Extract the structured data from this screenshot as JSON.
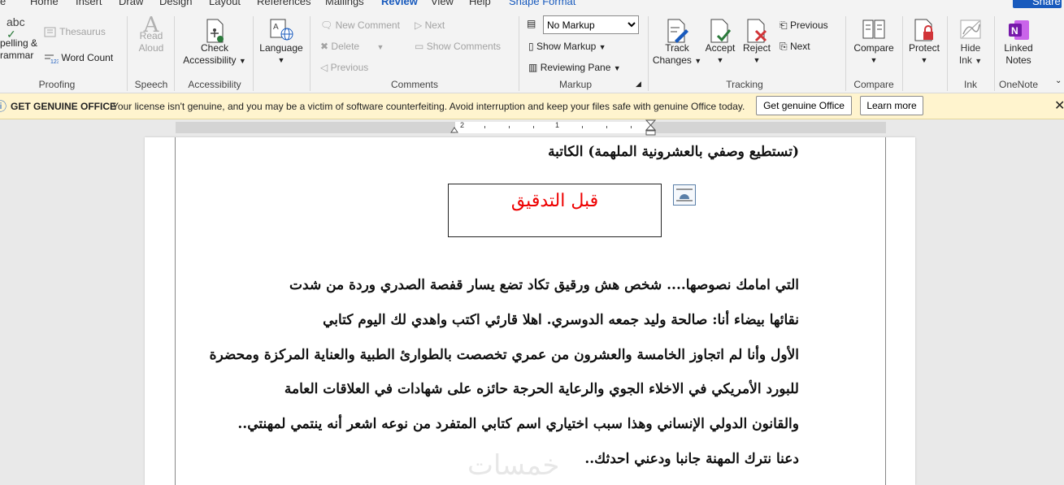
{
  "tabs": [
    "e",
    "Home",
    "Insert",
    "Draw",
    "Design",
    "Layout",
    "References",
    "Mailings",
    "Review",
    "View",
    "Help",
    "Shape Format"
  ],
  "share_label": "Share",
  "ribbon": {
    "proofing": {
      "spelling": "pelling &",
      "grammar": "rammar",
      "thesaurus": "Thesaurus",
      "word_count": "Word Count",
      "label": "Proofing"
    },
    "speech": {
      "read": "Read",
      "aloud": "Aloud",
      "label": "Speech"
    },
    "accessibility": {
      "check": "Check",
      "access": "Accessibility",
      "label": "Accessibility"
    },
    "language": {
      "btn": "Language",
      "label": ""
    },
    "comments": {
      "new": "New Comment",
      "delete": "Delete",
      "previous": "Previous",
      "next": "Next",
      "show": "Show Comments",
      "label": "Comments"
    },
    "markup": {
      "select": "No Markup",
      "show_markup": "Show Markup",
      "reviewing_pane": "Reviewing Pane",
      "label": "Markup"
    },
    "tracking": {
      "track": "Track",
      "changes": "Changes",
      "accept": "Accept",
      "reject": "Reject",
      "previous": "Previous",
      "next": "Next",
      "label": "Tracking"
    },
    "compare": {
      "btn": "Compare",
      "label": "Compare"
    },
    "protect": {
      "btn": "Protect",
      "label": ""
    },
    "ink": {
      "hide": "Hide",
      "ink": "Ink",
      "label": "Ink"
    },
    "onenote": {
      "linked": "Linked",
      "notes": "Notes",
      "label": "OneNote"
    }
  },
  "banner": {
    "title": "GET GENUINE OFFICE",
    "message": "Your license isn't genuine, and you may be a victim of software counterfeiting. Avoid interruption and keep your files safe with genuine Office today.",
    "get_btn": "Get genuine Office",
    "learn_btn": "Learn more"
  },
  "ruler": {
    "n2": "2",
    "n1": "1"
  },
  "document": {
    "line0": "(تستطيع وصفي بالعشرونية الملهمة) الكاتبة",
    "box_title": "قبل التدقيق",
    "lines": [
      "التي امامك نصوصها.... شخص هش ورقيق تكاد تضع يسار قفصة الصدري وردة من شدت",
      "نقائها بيضاء أنا: صالحة وليد جمعه الدوسري.          اهلا قارئي اكتب واهدي لك اليوم كتابي",
      "الأول وأنا لم اتجاوز الخامسة والعشرون من عمري تخصصت بالطوارئ الطبية والعناية المركزة ومحضرة",
      "للبورد الأمريكي في الاخلاء الجوي والرعاية الحرجة حائزه على شهادات في العلاقات العامة",
      "والقانون الدولي الإنساني وهذا سبب اختياري اسم كتابي المتفرد من نوعه اشعر أنه ينتمي لمهنتي..",
      "دعنا نترك المهنة جانبا ودعني احدثك.."
    ],
    "watermark": "خمسات"
  }
}
